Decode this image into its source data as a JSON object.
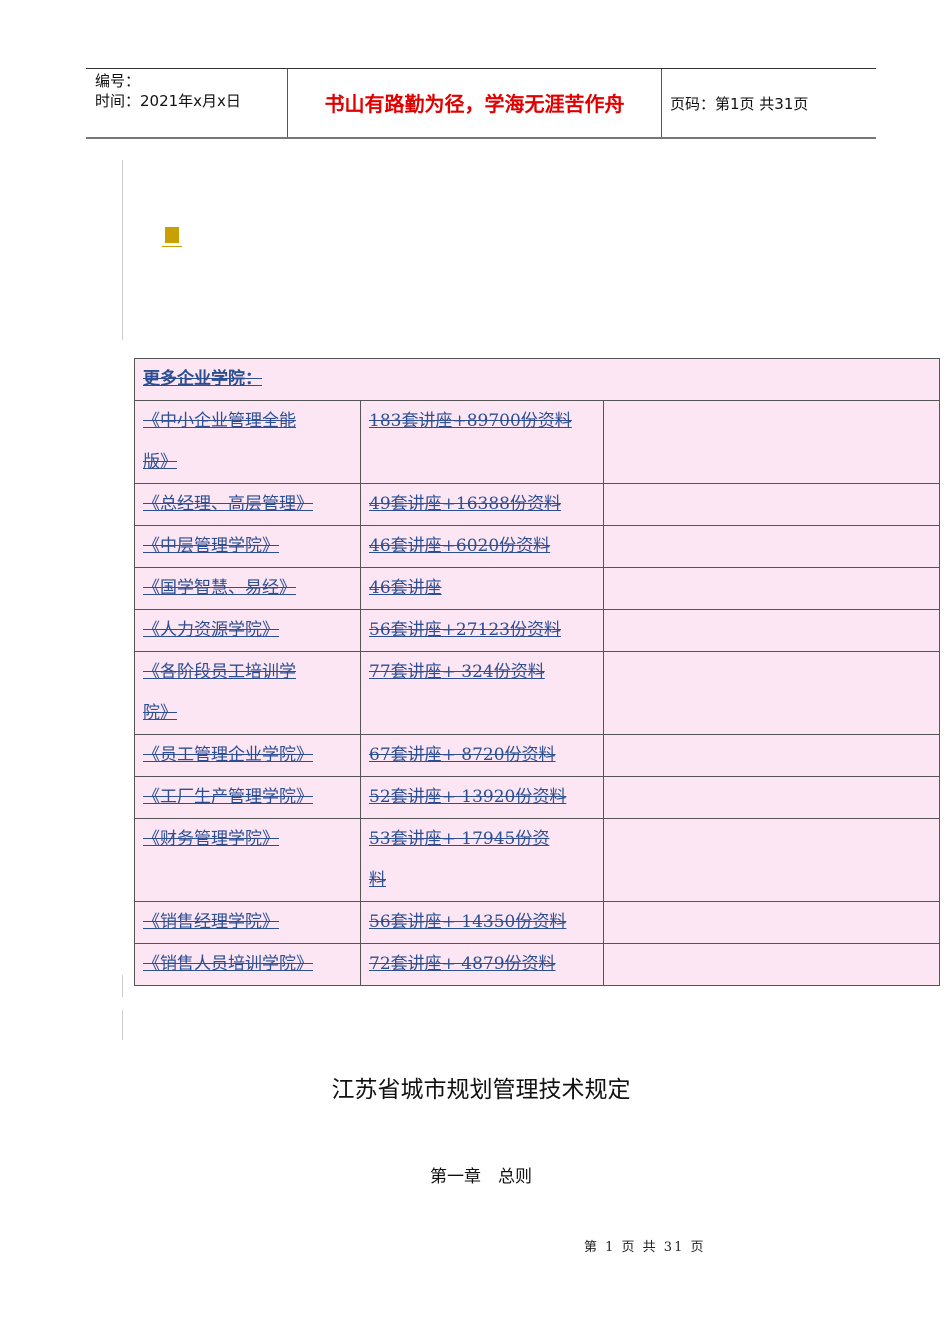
{
  "header": {
    "number_label": "编号：",
    "date_label": "时间：2021年x月x日",
    "motto": "书山有路勤为径，学海无涯苦作舟",
    "page_info": "页码：第1页  共31页"
  },
  "table": {
    "heading": "更多企业学院：",
    "rows": [
      {
        "name": [
          "《中小企业管理全能",
          "版》"
        ],
        "desc": [
          "183套讲座+89700份资料"
        ]
      },
      {
        "name": [
          "《总经理、高层管理》"
        ],
        "desc": [
          "49套讲座+16388份资料"
        ]
      },
      {
        "name": [
          "《中层管理学院》"
        ],
        "desc": [
          "46套讲座+6020份资料"
        ]
      },
      {
        "name": [
          "《国学智慧、易经》"
        ],
        "desc": [
          "46套讲座"
        ]
      },
      {
        "name": [
          "《人力资源学院》"
        ],
        "desc": [
          "56套讲座+27123份资料"
        ]
      },
      {
        "name": [
          "《各阶段员工培训学",
          "院》"
        ],
        "desc": [
          "77套讲座+ 324份资料"
        ]
      },
      {
        "name": [
          "《员工管理企业学院》"
        ],
        "desc": [
          "67套讲座+ 8720份资料"
        ]
      },
      {
        "name": [
          "《工厂生产管理学院》"
        ],
        "desc": [
          "52套讲座+ 13920份资料"
        ]
      },
      {
        "name": [
          "《财务管理学院》"
        ],
        "desc": [
          "53套讲座+ 17945份资",
          "料"
        ]
      },
      {
        "name": [
          "《销售经理学院》"
        ],
        "desc": [
          "56套讲座+ 14350份资料"
        ]
      },
      {
        "name": [
          "《销售人员培训学院》"
        ],
        "desc": [
          "72套讲座+ 4879份资料"
        ]
      }
    ]
  },
  "doc": {
    "title": "江苏省城市规划管理技术规定",
    "chapter": "第一章　总则",
    "footer": "第 1 页 共 31 页"
  }
}
